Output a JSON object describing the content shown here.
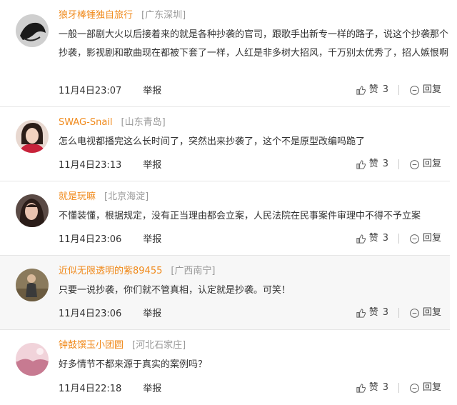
{
  "comments": [
    {
      "user": "狼牙棒锤独自旅行",
      "location": "[广东深圳]",
      "text": "一般一部剧大火以后接着来的就是各种抄袭的官司，跟歌手出新专一样的路子，说这个抄袭那个抄袭，影视剧和歌曲现在都被下套了一样，人红是非多树大招风，千万别太优秀了，招人嫉恨啊",
      "time": "11月4日23:07",
      "report": "举报",
      "like_label": "赞",
      "likes": "3",
      "reply": "回复",
      "avatar_icon": "avatar-dark-silhouette"
    },
    {
      "user": "SWAG-Snail",
      "location": "[山东青岛]",
      "text": "怎么电视都播完这么长时间了，突然出来抄袭了，这个不是原型改编吗跪了",
      "time": "11月4日23:13",
      "report": "举报",
      "like_label": "赞",
      "likes": "3",
      "reply": "回复",
      "avatar_icon": "avatar-girl-red"
    },
    {
      "user": "就是玩嘛",
      "location": "[北京海淀]",
      "text": "不懂装懂，根据规定，没有正当理由都会立案，人民法院在民事案件审理中不得不予立案",
      "time": "11月4日23:06",
      "report": "举报",
      "like_label": "赞",
      "likes": "3",
      "reply": "回复",
      "avatar_icon": "avatar-girl-dark"
    },
    {
      "user": "近似无限透明的紫89455",
      "location": "[广西南宁]",
      "text": "只要一说抄袭，你们就不管真相，认定就是抄袭。可笑！",
      "time": "11月4日23:06",
      "report": "举报",
      "like_label": "赞",
      "likes": "3",
      "reply": "回复",
      "avatar_icon": "avatar-man-sitting"
    },
    {
      "user": "钟鼓馔玉小团圆",
      "location": "[河北石家庄]",
      "text": "好多情节不都来源于真实的案例吗？",
      "time": "11月4日22:18",
      "report": "举报",
      "like_label": "赞",
      "likes": "3",
      "reply": "回复",
      "avatar_icon": "avatar-pink-landscape"
    }
  ],
  "colors": {
    "username": "#f08a1c",
    "location": "#999999",
    "text": "#333333",
    "shaded_row": "#f7f7f7"
  }
}
